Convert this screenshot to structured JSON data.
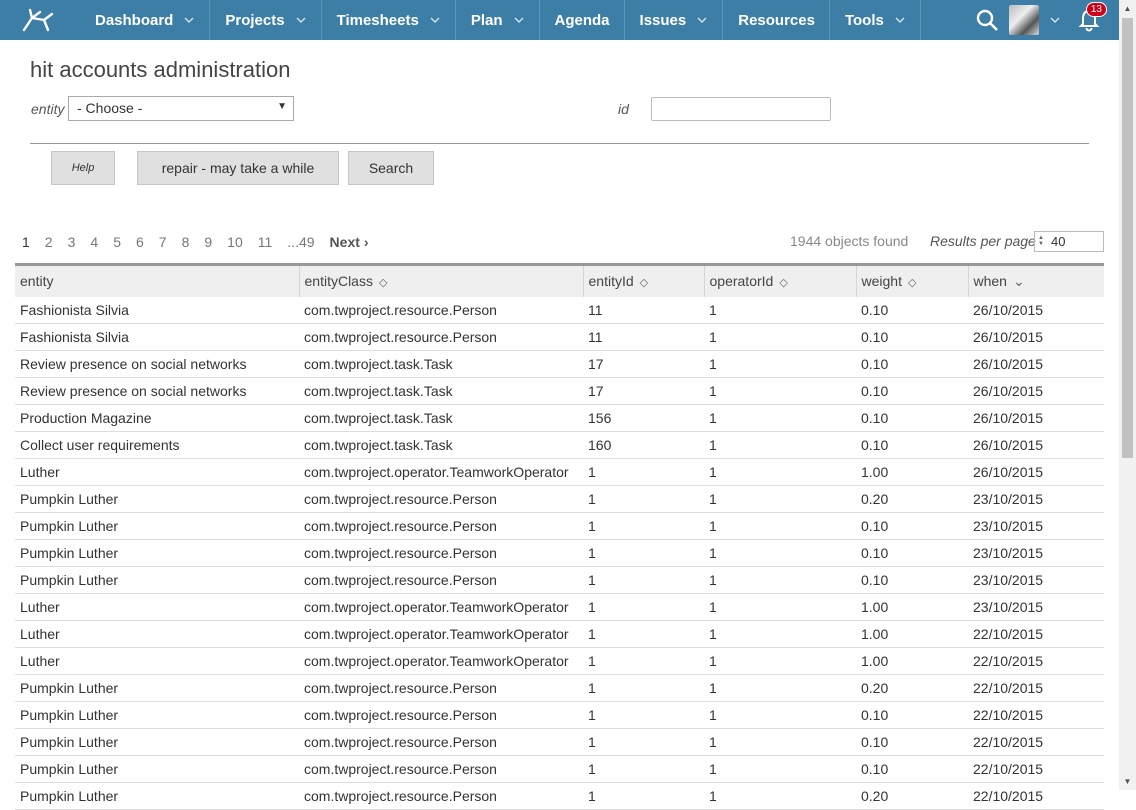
{
  "nav": {
    "items": [
      {
        "label": "Dashboard",
        "has_menu": true
      },
      {
        "label": "Projects",
        "has_menu": true
      },
      {
        "label": "Timesheets",
        "has_menu": true
      },
      {
        "label": "Plan",
        "has_menu": true
      },
      {
        "label": "Agenda",
        "has_menu": false
      },
      {
        "label": "Issues",
        "has_menu": true
      },
      {
        "label": "Resources",
        "has_menu": false
      },
      {
        "label": "Tools",
        "has_menu": true
      }
    ],
    "notifications_count": "13",
    "accent_color": "#3d7ea6"
  },
  "page": {
    "title": "hit accounts administration",
    "entity_label": "entity",
    "entity_value": "- Choose -",
    "id_label": "id",
    "id_value": ""
  },
  "buttons": {
    "help": "Help",
    "repair": "repair - may take a while",
    "search": "Search"
  },
  "pager": {
    "pages": [
      "1",
      "2",
      "3",
      "4",
      "5",
      "6",
      "7",
      "8",
      "9",
      "10",
      "11",
      "...49"
    ],
    "current": "1",
    "next": "Next",
    "found": "1944 objects found",
    "rpp_label": "Results per page",
    "rpp_value": "40"
  },
  "table": {
    "columns": [
      "entity",
      "entityClass",
      "entityId",
      "operatorId",
      "weight",
      "when"
    ],
    "rows": [
      [
        "Fashionista Silvia",
        "com.twproject.resource.Person",
        "11",
        "1",
        "0.10",
        "26/10/2015"
      ],
      [
        "Fashionista Silvia",
        "com.twproject.resource.Person",
        "11",
        "1",
        "0.10",
        "26/10/2015"
      ],
      [
        "Review presence on social networks",
        "com.twproject.task.Task",
        "17",
        "1",
        "0.10",
        "26/10/2015"
      ],
      [
        "Review presence on social networks",
        "com.twproject.task.Task",
        "17",
        "1",
        "0.10",
        "26/10/2015"
      ],
      [
        "Production Magazine",
        "com.twproject.task.Task",
        "156",
        "1",
        "0.10",
        "26/10/2015"
      ],
      [
        "Collect user requirements",
        "com.twproject.task.Task",
        "160",
        "1",
        "0.10",
        "26/10/2015"
      ],
      [
        "Luther",
        "com.twproject.operator.TeamworkOperator",
        "1",
        "1",
        "1.00",
        "26/10/2015"
      ],
      [
        "Pumpkin Luther",
        "com.twproject.resource.Person",
        "1",
        "1",
        "0.20",
        "23/10/2015"
      ],
      [
        "Pumpkin Luther",
        "com.twproject.resource.Person",
        "1",
        "1",
        "0.10",
        "23/10/2015"
      ],
      [
        "Pumpkin Luther",
        "com.twproject.resource.Person",
        "1",
        "1",
        "0.10",
        "23/10/2015"
      ],
      [
        "Pumpkin Luther",
        "com.twproject.resource.Person",
        "1",
        "1",
        "0.10",
        "23/10/2015"
      ],
      [
        "Luther",
        "com.twproject.operator.TeamworkOperator",
        "1",
        "1",
        "1.00",
        "23/10/2015"
      ],
      [
        "Luther",
        "com.twproject.operator.TeamworkOperator",
        "1",
        "1",
        "1.00",
        "22/10/2015"
      ],
      [
        "Luther",
        "com.twproject.operator.TeamworkOperator",
        "1",
        "1",
        "1.00",
        "22/10/2015"
      ],
      [
        "Pumpkin Luther",
        "com.twproject.resource.Person",
        "1",
        "1",
        "0.20",
        "22/10/2015"
      ],
      [
        "Pumpkin Luther",
        "com.twproject.resource.Person",
        "1",
        "1",
        "0.10",
        "22/10/2015"
      ],
      [
        "Pumpkin Luther",
        "com.twproject.resource.Person",
        "1",
        "1",
        "0.10",
        "22/10/2015"
      ],
      [
        "Pumpkin Luther",
        "com.twproject.resource.Person",
        "1",
        "1",
        "0.10",
        "22/10/2015"
      ],
      [
        "Pumpkin Luther",
        "com.twproject.resource.Person",
        "1",
        "1",
        "0.20",
        "22/10/2015"
      ]
    ]
  }
}
